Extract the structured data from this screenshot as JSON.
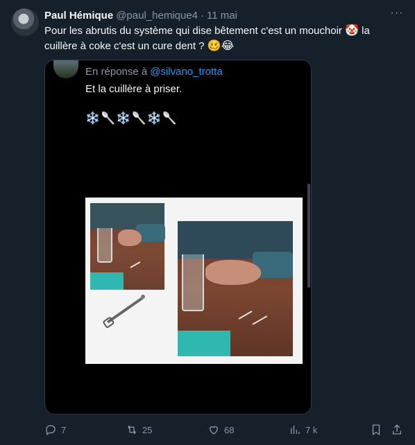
{
  "tweet": {
    "author_name": "Paul Hémique",
    "author_handle": "@paul_hemique4",
    "separator": "·",
    "date": "11 mai",
    "text_part1": "Pour les abrutis du système qui dise bêtement c'est un mouchoir ",
    "emoji_clown": "🤡",
    "text_part2": " la cuillère à coke c'est un cure dent ? ",
    "emoji_end": "🥴😂"
  },
  "quoted": {
    "reply_prefix": "En réponse à",
    "reply_handle": "@silvano_trotta",
    "text": "Et la cuillère à priser.",
    "flakes": "❄️🥄❄️🥄❄️🥄"
  },
  "actions": {
    "replies": "7",
    "retweets": "25",
    "likes": "68",
    "views": "7 k"
  },
  "colors": {
    "background": "#15202b",
    "text": "#f7f9f9",
    "muted": "#8b98a5",
    "link": "#1d9bf0"
  },
  "icons": [
    "more-icon",
    "reply-icon",
    "retweet-icon",
    "like-icon",
    "views-icon",
    "bookmark-icon",
    "share-icon"
  ]
}
